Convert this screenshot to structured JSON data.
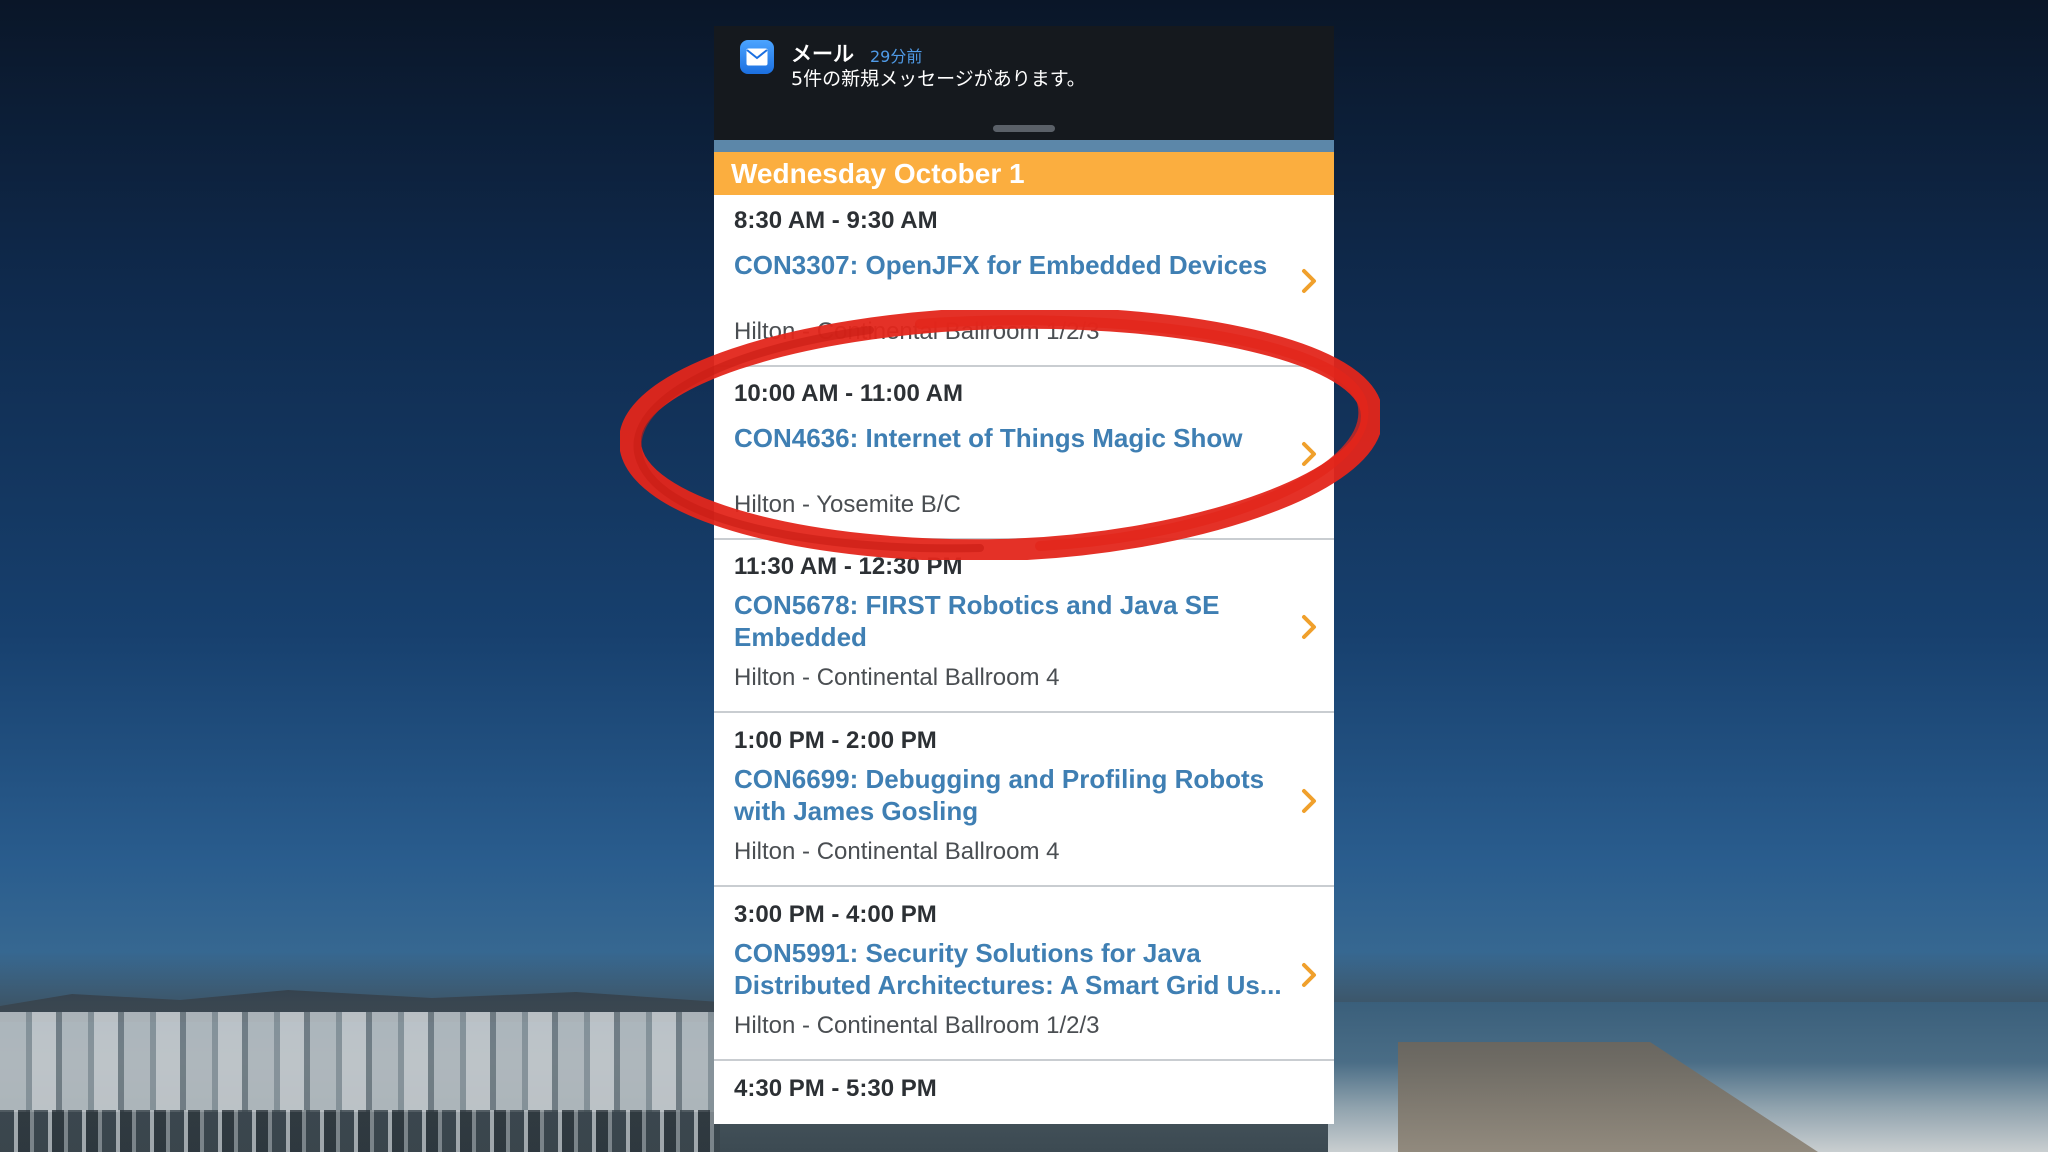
{
  "notification": {
    "app_name": "メール",
    "time_ago": "29分前",
    "message": "5件の新規メッセージがあります。",
    "icon": "mail-icon"
  },
  "schedule": {
    "day_header": "Wednesday October 1",
    "accent_color": "#fbae3f",
    "link_color": "#3f7fb3",
    "sessions": [
      {
        "time": "8:30 AM - 9:30 AM",
        "title": "CON3307: OpenJFX for Embedded Devices",
        "location": "Hilton - Continental Ballroom 1/2/3"
      },
      {
        "time": "10:00 AM - 11:00 AM",
        "title": "CON4636: Internet of Things Magic Show",
        "location": "Hilton - Yosemite B/C"
      },
      {
        "time": "11:30 AM - 12:30 PM",
        "title": "CON5678: FIRST Robotics and Java SE Embedded",
        "location": "Hilton - Continental Ballroom 4"
      },
      {
        "time": "1:00 PM - 2:00 PM",
        "title": "CON6699: Debugging and Profiling Robots with James Gosling",
        "location": "Hilton - Continental Ballroom 4"
      },
      {
        "time": "3:00 PM - 4:00 PM",
        "title": "CON5991: Security Solutions for Java Distributed Architectures: A Smart Grid Us...",
        "location": "Hilton - Continental Ballroom 1/2/3"
      },
      {
        "time": "4:30 PM - 5:30 PM"
      }
    ]
  },
  "annotation": {
    "highlighted_session": "CON4636: Internet of Things Magic Show",
    "color": "#e3261b"
  }
}
